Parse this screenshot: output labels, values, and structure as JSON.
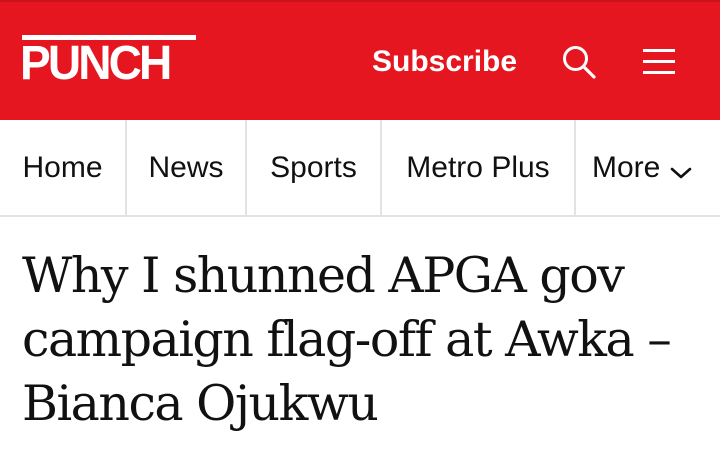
{
  "header": {
    "logo_text": "PUNCH",
    "subscribe_label": "Subscribe",
    "search_icon": "search-icon",
    "menu_icon": "hamburger-menu-icon",
    "brand_color": "#e5161f"
  },
  "nav": {
    "items": [
      {
        "label": "Home"
      },
      {
        "label": "News"
      },
      {
        "label": "Sports"
      },
      {
        "label": "Metro Plus"
      },
      {
        "label": "More",
        "icon": "chevron-down-icon"
      }
    ]
  },
  "article": {
    "headline": "Why I shunned APGA gov campaign flag-off at Awka –Bianca Ojukwu"
  }
}
